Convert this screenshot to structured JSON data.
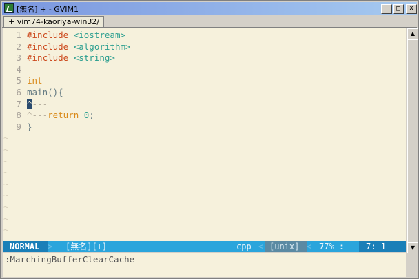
{
  "window": {
    "title": "[無名] + - GVIM1",
    "buttons": {
      "minimize": "_",
      "maximize": "□",
      "close": "X"
    }
  },
  "tabs": [
    {
      "label": "+ vim74-kaoriya-win32/"
    }
  ],
  "editor": {
    "lines": [
      {
        "num": "1",
        "parts": [
          {
            "cls": "c-pre",
            "text": "#include "
          },
          {
            "cls": "c-str",
            "text": "<iostream>"
          }
        ]
      },
      {
        "num": "2",
        "parts": [
          {
            "cls": "c-pre",
            "text": "#include "
          },
          {
            "cls": "c-str",
            "text": "<algorithm>"
          }
        ]
      },
      {
        "num": "3",
        "parts": [
          {
            "cls": "c-pre",
            "text": "#include "
          },
          {
            "cls": "c-str",
            "text": "<string>"
          }
        ]
      },
      {
        "num": "4",
        "parts": []
      },
      {
        "num": "5",
        "parts": [
          {
            "cls": "c-kw",
            "text": "int"
          }
        ]
      },
      {
        "num": "6",
        "parts": [
          {
            "cls": "c-fn",
            "text": "main(){"
          }
        ]
      },
      {
        "num": "7",
        "parts": [
          {
            "cls": "cursor",
            "text": "^"
          },
          {
            "cls": "c-tab",
            "text": "---"
          }
        ]
      },
      {
        "num": "8",
        "parts": [
          {
            "cls": "c-tab",
            "text": "^---"
          },
          {
            "cls": "c-kw",
            "text": "return "
          },
          {
            "cls": "c-num",
            "text": "0"
          },
          {
            "cls": "c-fn",
            "text": ";"
          }
        ]
      },
      {
        "num": "9",
        "parts": [
          {
            "cls": "c-br",
            "text": "}"
          }
        ]
      }
    ],
    "filler": "~"
  },
  "statusline": {
    "mode": "NORMAL",
    "sep_right": ">",
    "file": "[無名][+]",
    "filetype": "cpp",
    "sep_left": "<",
    "fileformat": "[unix]",
    "percent": "77% :",
    "position": "7:  1"
  },
  "cmdline": ":MarchingBufferClearCache",
  "colors": {
    "editor_bg": "#f6f1dc",
    "statusline_bg": "#2aa5dc",
    "mode_bg": "#1a7fb8",
    "preproc": "#cc4a1e",
    "string": "#2a9e8f",
    "keyword": "#d98a1a"
  }
}
